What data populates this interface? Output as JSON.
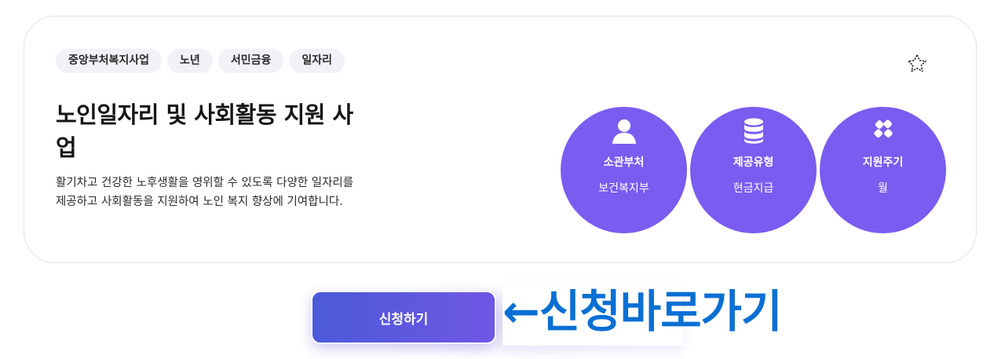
{
  "tags": [
    "중앙부처복지사업",
    "노년",
    "서민금융",
    "일자리"
  ],
  "title": "노인일자리 및 사회활동 지원 사업",
  "description": "활기차고 건강한 노후생활을 영위할 수 있도록 다양한 일자리를 제공하고 사회활동을 지원하여 노인 복지 향상에 기여합니다.",
  "info": [
    {
      "label": "소관부처",
      "value": "보건복지부",
      "icon": "person-icon"
    },
    {
      "label": "제공유형",
      "value": "현금지급",
      "icon": "database-icon"
    },
    {
      "label": "지원주기",
      "value": "월",
      "icon": "grid-diamond-icon"
    }
  ],
  "apply_label": "신청하기",
  "annotation": "←신청바로가기",
  "colors": {
    "accent": "#7a5cf0",
    "button_start": "#4b5ad9",
    "button_end": "#6f57e4",
    "annotation": "#0a6fd4",
    "tag_bg": "#f1f1f8"
  },
  "favorite_icon": "star-outline-icon"
}
